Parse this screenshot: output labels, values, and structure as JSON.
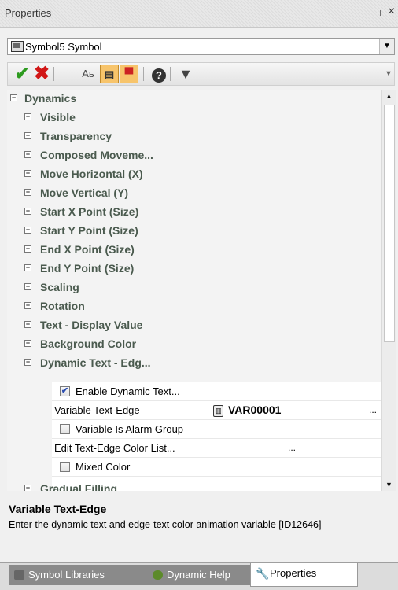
{
  "panel": {
    "title": "Properties",
    "pin_glyph": "ᵼ",
    "close_glyph": "×"
  },
  "selector": {
    "value": "Symbol5 Symbol",
    "icon": "symbol-icon",
    "dropdown_glyph": "▼"
  },
  "toolbar": {
    "check_glyph": "✔",
    "x_glyph": "✖",
    "categorized_glyph": "▦",
    "alphabetical_glyph": "Aь",
    "pages_glyph": "▤",
    "comment_glyph": "▀",
    "help_glyph": "?",
    "filter_glyph": "▼",
    "overflow_glyph": "▾"
  },
  "tree": {
    "root": {
      "label": "Dynamics",
      "expander": "⊟"
    },
    "items": [
      {
        "label": "Visible",
        "expander": "+"
      },
      {
        "label": "Transparency",
        "expander": "+"
      },
      {
        "label": "Composed Moveme...",
        "expander": "+"
      },
      {
        "label": "Move Horizontal (X)",
        "expander": "+"
      },
      {
        "label": "Move Vertical (Y)",
        "expander": "+"
      },
      {
        "label": "Start X Point (Size)",
        "expander": "+"
      },
      {
        "label": "Start Y Point (Size)",
        "expander": "+"
      },
      {
        "label": "End X Point (Size)",
        "expander": "+"
      },
      {
        "label": "End Y Point (Size)",
        "expander": "+"
      },
      {
        "label": "Scaling",
        "expander": "+"
      },
      {
        "label": "Rotation",
        "expander": "+"
      },
      {
        "label": "Text - Display Value",
        "expander": "+"
      },
      {
        "label": "Background Color",
        "expander": "+"
      },
      {
        "label": "Dynamic Text - Edg...",
        "expander": "−"
      }
    ],
    "props": [
      {
        "name": "Enable Dynamic Text...",
        "checked": true,
        "check_glyph": "✔",
        "value": ""
      },
      {
        "name": "Variable Text-Edge",
        "value": "VAR00001",
        "value_icon": "variable-tag-icon",
        "ellipsis": "..."
      },
      {
        "name": "Variable Is Alarm Group",
        "checked": false,
        "value": ""
      },
      {
        "name": "Edit Text-Edge Color List...",
        "value": "..."
      },
      {
        "name": "Mixed Color",
        "checked": false,
        "value": ""
      }
    ],
    "after": {
      "label": "Gradual Filling",
      "expander": "+"
    }
  },
  "scrollbar": {
    "up_glyph": "▲",
    "down_glyph": "▼"
  },
  "description": {
    "title": "Variable Text-Edge",
    "text": "Enter the dynamic text and edge-text color animation variable [ID12646]"
  },
  "tabs": [
    {
      "label": "Symbol Libraries",
      "icon": "library-icon"
    },
    {
      "label": "Dynamic Help",
      "icon": "help-globe-icon"
    },
    {
      "label": "Properties",
      "icon": "wrench-icon",
      "glyph": "🔧",
      "active": true
    }
  ]
}
